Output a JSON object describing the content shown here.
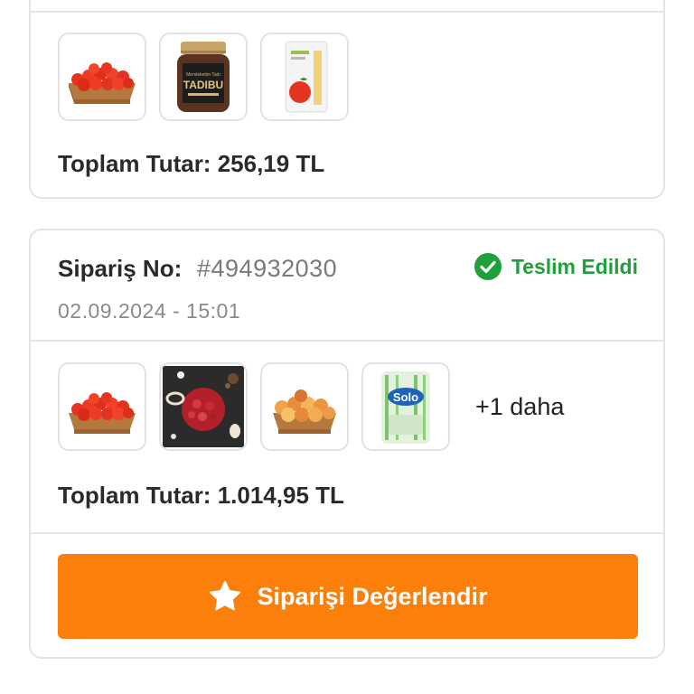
{
  "orders": [
    {
      "products": [
        {
          "name": "Domates",
          "icon": "tomato-crate"
        },
        {
          "name": "Tadıbu",
          "icon": "spread-jar",
          "brand_text": "TADIBU"
        },
        {
          "name": "Domates Paketi",
          "icon": "tomato-bag"
        }
      ],
      "total_label": "Toplam Tutar: 256,19 TL"
    },
    {
      "order_label": "Sipariş No:",
      "order_number": "#494932030",
      "date": "02.09.2024 - 15:01",
      "status": "Teslim Edildi",
      "products": [
        {
          "name": "Domates",
          "icon": "tomato-crate"
        },
        {
          "name": "Kıyma",
          "icon": "minced-meat"
        },
        {
          "name": "Şeftali",
          "icon": "peach-crate"
        },
        {
          "name": "Solo",
          "icon": "paper-towel",
          "brand_text": "Solo"
        }
      ],
      "more_label": "+1 daha",
      "total_label": "Toplam Tutar: 1.014,95 TL",
      "rate_button": "Siparişi Değerlendir"
    }
  ],
  "colors": {
    "accent": "#fb7f0a",
    "status_green": "#1fa03a",
    "border": "#e4e4e4"
  }
}
